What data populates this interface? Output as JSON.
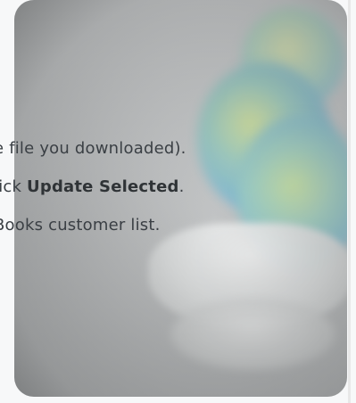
{
  "image_panel": {
    "name": "illustration"
  },
  "steps": [
    {
      "text": "e file you downloaded)."
    },
    {
      "prefix": "lick ",
      "strong": "Update Selected",
      "suffix": "."
    },
    {
      "text": "Books customer list."
    }
  ]
}
